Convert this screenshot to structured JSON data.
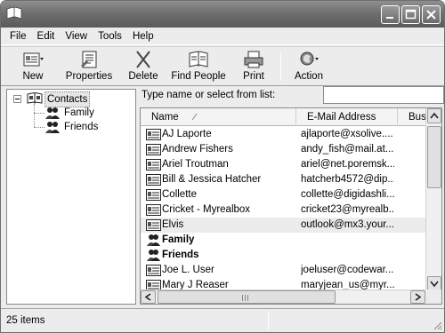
{
  "menu": [
    "File",
    "Edit",
    "View",
    "Tools",
    "Help"
  ],
  "toolbar": {
    "new": "New",
    "properties": "Properties",
    "delete": "Delete",
    "find_people": "Find People",
    "print": "Print",
    "action": "Action"
  },
  "tree": {
    "root": "Contacts",
    "children": [
      "Family",
      "Friends"
    ]
  },
  "search": {
    "label": "Type name or select from list:",
    "value": ""
  },
  "list": {
    "columns": [
      "Name",
      "E-Mail Address",
      "Busin"
    ],
    "rows": [
      {
        "name": "AJ Laporte",
        "email": "ajlaporte@xsolive....",
        "kind": "contact"
      },
      {
        "name": "Andrew Fishers",
        "email": "andy_fish@mail.at...",
        "kind": "contact"
      },
      {
        "name": "Ariel Troutman",
        "email": "ariel@net.poremsk...",
        "kind": "contact"
      },
      {
        "name": "Bill & Jessica Hatcher",
        "email": "hatcherb4572@dip...",
        "kind": "contact"
      },
      {
        "name": "Collette",
        "email": "collette@digidashli...",
        "kind": "contact"
      },
      {
        "name": "Cricket - Myrealbox",
        "email": "cricket23@myrealb...",
        "kind": "contact"
      },
      {
        "name": "Elvis",
        "email": "outlook@mx3.your....",
        "kind": "contact",
        "selected": true
      },
      {
        "name": "Family",
        "email": "",
        "kind": "group"
      },
      {
        "name": "Friends",
        "email": "",
        "kind": "group"
      },
      {
        "name": "Joe L. User",
        "email": "joeluser@codewar...",
        "kind": "contact"
      },
      {
        "name": "Mary J Reaser",
        "email": "maryjean_us@myr...",
        "kind": "contact"
      }
    ]
  },
  "status": {
    "count": "25 items"
  },
  "colors": {
    "titlebar": "#6f6f6f",
    "chrome": "#ececec",
    "selection": "#ececec"
  },
  "icons": {
    "app": "address-book-icon",
    "minimize": "minimize-icon",
    "maximize": "maximize-icon",
    "close": "close-icon",
    "contact": "contact-card-icon",
    "group": "group-people-icon"
  }
}
